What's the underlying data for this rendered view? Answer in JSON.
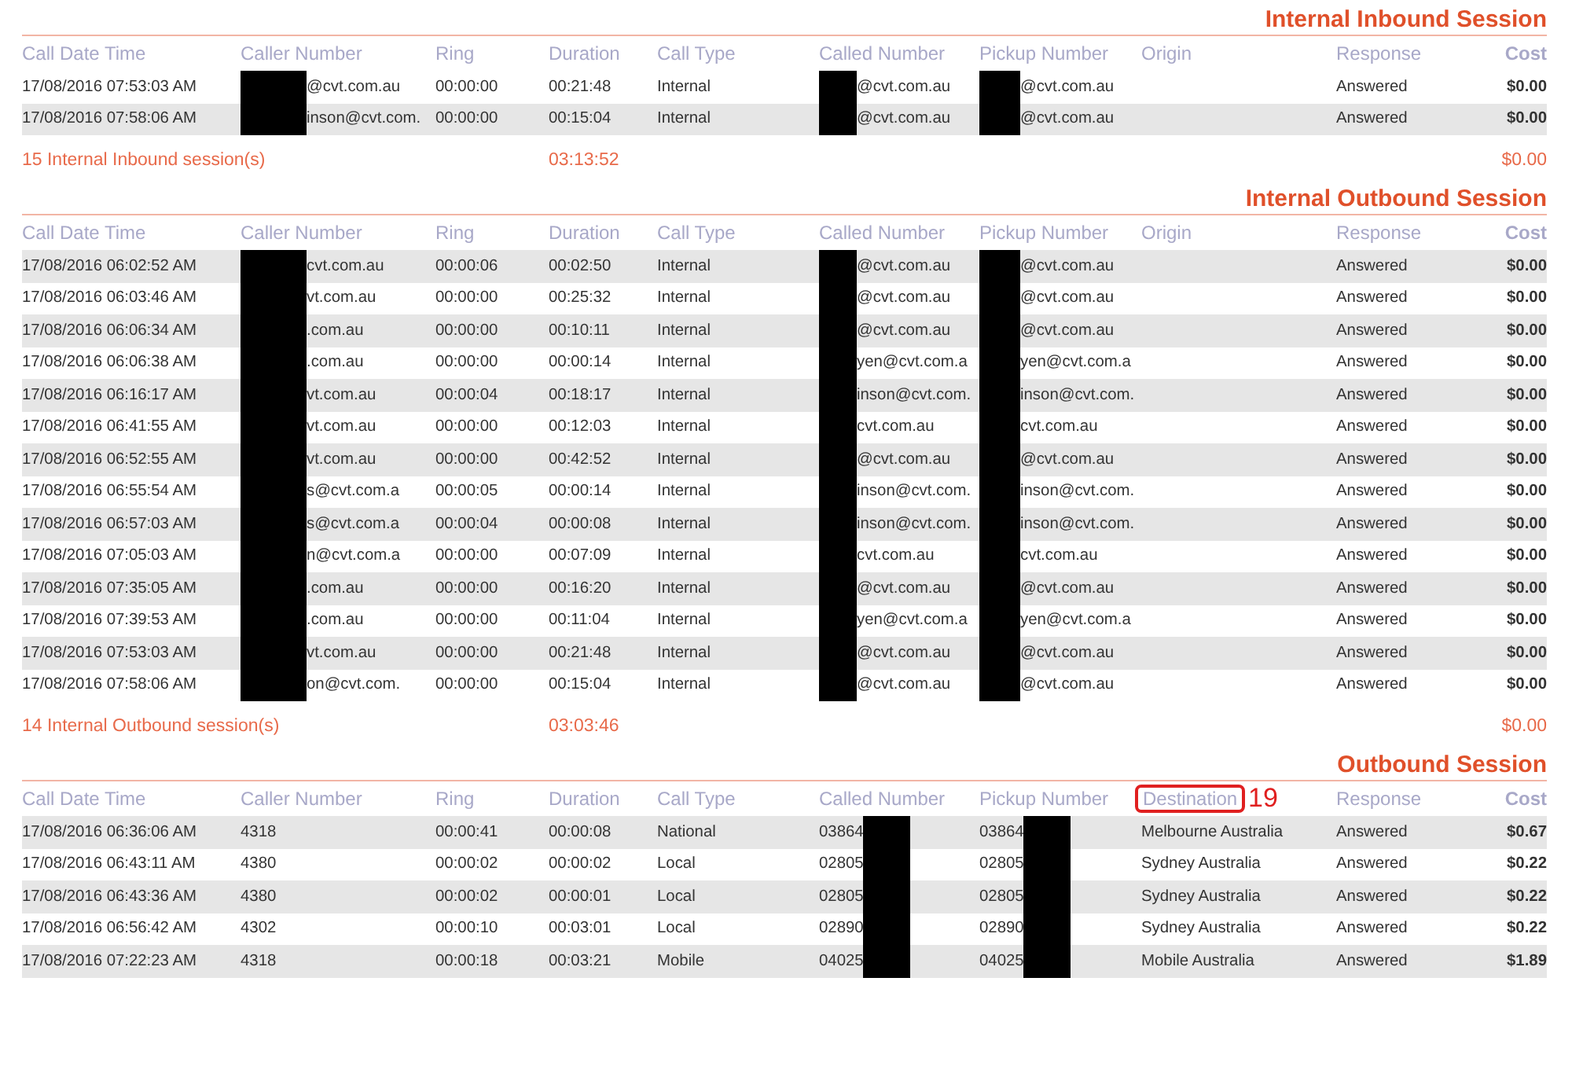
{
  "sections": [
    {
      "title": "Internal Inbound Session",
      "columns": [
        {
          "label": "Call Date Time"
        },
        {
          "label": "Caller Number"
        },
        {
          "label": "Ring"
        },
        {
          "label": "Duration"
        },
        {
          "label": "Call Type"
        },
        {
          "label": "Called Number"
        },
        {
          "label": "Pickup Number"
        },
        {
          "label": "Origin"
        },
        {
          "label": "Response"
        },
        {
          "label": "Cost"
        }
      ],
      "rows": [
        {
          "shaded": false,
          "date": "17/08/2016 07:53:03 AM",
          "caller": {
            "text": "@cvt.com.au",
            "redacted_before": true
          },
          "ring": "00:00:00",
          "duration": "00:21:48",
          "call_type": "Internal",
          "called": {
            "text": "@cvt.com.au",
            "redacted_before": true
          },
          "pickup": {
            "text": "@cvt.com.au",
            "redacted_before": true
          },
          "response": "Answered",
          "cost": "$0.00"
        },
        {
          "shaded": true,
          "date": "17/08/2016 07:58:06 AM",
          "caller": {
            "text": "inson@cvt.com.",
            "redacted_before": true
          },
          "ring": "00:00:00",
          "duration": "00:15:04",
          "call_type": "Internal",
          "called": {
            "text": "@cvt.com.au",
            "redacted_before": true
          },
          "pickup": {
            "text": "@cvt.com.au",
            "redacted_before": true
          },
          "response": "Answered",
          "cost": "$0.00"
        }
      ],
      "summary": {
        "count": "15 Internal Inbound session(s)",
        "total_duration": "03:13:52",
        "total_cost": "$0.00"
      }
    },
    {
      "title": "Internal Outbound Session",
      "columns": [
        {
          "label": "Call Date Time"
        },
        {
          "label": "Caller Number"
        },
        {
          "label": "Ring"
        },
        {
          "label": "Duration"
        },
        {
          "label": "Call Type"
        },
        {
          "label": "Called Number"
        },
        {
          "label": "Pickup Number"
        },
        {
          "label": "Origin"
        },
        {
          "label": "Response"
        },
        {
          "label": "Cost"
        }
      ],
      "rows": [
        {
          "shaded": true,
          "date": "17/08/2016 06:02:52 AM",
          "caller": {
            "text": "cvt.com.au",
            "redacted_before": true
          },
          "ring": "00:00:06",
          "duration": "00:02:50",
          "call_type": "Internal",
          "called": {
            "text": "@cvt.com.au",
            "redacted_before": true
          },
          "pickup": {
            "text": "@cvt.com.au",
            "redacted_before": true
          },
          "response": "Answered",
          "cost": "$0.00"
        },
        {
          "shaded": false,
          "date": "17/08/2016 06:03:46 AM",
          "caller": {
            "text": "vt.com.au",
            "redacted_before": true
          },
          "ring": "00:00:00",
          "duration": "00:25:32",
          "call_type": "Internal",
          "called": {
            "text": "@cvt.com.au",
            "redacted_before": true
          },
          "pickup": {
            "text": "@cvt.com.au",
            "redacted_before": true
          },
          "response": "Answered",
          "cost": "$0.00"
        },
        {
          "shaded": true,
          "date": "17/08/2016 06:06:34 AM",
          "caller": {
            "text": ".com.au",
            "redacted_before": true
          },
          "ring": "00:00:00",
          "duration": "00:10:11",
          "call_type": "Internal",
          "called": {
            "text": "@cvt.com.au",
            "redacted_before": true
          },
          "pickup": {
            "text": "@cvt.com.au",
            "redacted_before": true
          },
          "response": "Answered",
          "cost": "$0.00"
        },
        {
          "shaded": false,
          "date": "17/08/2016 06:06:38 AM",
          "caller": {
            "text": ".com.au",
            "redacted_before": true
          },
          "ring": "00:00:00",
          "duration": "00:00:14",
          "call_type": "Internal",
          "called": {
            "text": "yen@cvt.com.a",
            "redacted_before": true
          },
          "pickup": {
            "text": "yen@cvt.com.a",
            "redacted_before": true
          },
          "response": "Answered",
          "cost": "$0.00"
        },
        {
          "shaded": true,
          "date": "17/08/2016 06:16:17 AM",
          "caller": {
            "text": "vt.com.au",
            "redacted_before": true
          },
          "ring": "00:00:04",
          "duration": "00:18:17",
          "call_type": "Internal",
          "called": {
            "text": "inson@cvt.com.",
            "redacted_before": true
          },
          "pickup": {
            "text": "inson@cvt.com.",
            "redacted_before": true
          },
          "response": "Answered",
          "cost": "$0.00"
        },
        {
          "shaded": false,
          "date": "17/08/2016 06:41:55 AM",
          "caller": {
            "text": "vt.com.au",
            "redacted_before": true
          },
          "ring": "00:00:00",
          "duration": "00:12:03",
          "call_type": "Internal",
          "called": {
            "text": "cvt.com.au",
            "redacted_before": true
          },
          "pickup": {
            "text": "cvt.com.au",
            "redacted_before": true
          },
          "response": "Answered",
          "cost": "$0.00"
        },
        {
          "shaded": true,
          "date": "17/08/2016 06:52:55 AM",
          "caller": {
            "text": "vt.com.au",
            "redacted_before": true
          },
          "ring": "00:00:00",
          "duration": "00:42:52",
          "call_type": "Internal",
          "called": {
            "text": "@cvt.com.au",
            "redacted_before": true
          },
          "pickup": {
            "text": "@cvt.com.au",
            "redacted_before": true
          },
          "response": "Answered",
          "cost": "$0.00"
        },
        {
          "shaded": false,
          "date": "17/08/2016 06:55:54 AM",
          "caller": {
            "text": "s@cvt.com.a",
            "redacted_before": true
          },
          "ring": "00:00:05",
          "duration": "00:00:14",
          "call_type": "Internal",
          "called": {
            "text": "inson@cvt.com.",
            "redacted_before": true
          },
          "pickup": {
            "text": "inson@cvt.com.",
            "redacted_before": true
          },
          "response": "Answered",
          "cost": "$0.00"
        },
        {
          "shaded": true,
          "date": "17/08/2016 06:57:03 AM",
          "caller": {
            "text": "s@cvt.com.a",
            "redacted_before": true
          },
          "ring": "00:00:04",
          "duration": "00:00:08",
          "call_type": "Internal",
          "called": {
            "text": "inson@cvt.com.",
            "redacted_before": true
          },
          "pickup": {
            "text": "inson@cvt.com.",
            "redacted_before": true
          },
          "response": "Answered",
          "cost": "$0.00"
        },
        {
          "shaded": false,
          "date": "17/08/2016 07:05:03 AM",
          "caller": {
            "text": "n@cvt.com.a",
            "redacted_before": true
          },
          "ring": "00:00:00",
          "duration": "00:07:09",
          "call_type": "Internal",
          "called": {
            "text": "cvt.com.au",
            "redacted_before": true
          },
          "pickup": {
            "text": "cvt.com.au",
            "redacted_before": true
          },
          "response": "Answered",
          "cost": "$0.00"
        },
        {
          "shaded": true,
          "date": "17/08/2016 07:35:05 AM",
          "caller": {
            "text": ".com.au",
            "redacted_before": true
          },
          "ring": "00:00:00",
          "duration": "00:16:20",
          "call_type": "Internal",
          "called": {
            "text": "@cvt.com.au",
            "redacted_before": true
          },
          "pickup": {
            "text": "@cvt.com.au",
            "redacted_before": true
          },
          "response": "Answered",
          "cost": "$0.00"
        },
        {
          "shaded": false,
          "date": "17/08/2016 07:39:53 AM",
          "caller": {
            "text": ".com.au",
            "redacted_before": true
          },
          "ring": "00:00:00",
          "duration": "00:11:04",
          "call_type": "Internal",
          "called": {
            "text": "yen@cvt.com.a",
            "redacted_before": true
          },
          "pickup": {
            "text": "yen@cvt.com.a",
            "redacted_before": true
          },
          "response": "Answered",
          "cost": "$0.00"
        },
        {
          "shaded": true,
          "date": "17/08/2016 07:53:03 AM",
          "caller": {
            "text": "vt.com.au",
            "redacted_before": true
          },
          "ring": "00:00:00",
          "duration": "00:21:48",
          "call_type": "Internal",
          "called": {
            "text": "@cvt.com.au",
            "redacted_before": true
          },
          "pickup": {
            "text": "@cvt.com.au",
            "redacted_before": true
          },
          "response": "Answered",
          "cost": "$0.00"
        },
        {
          "shaded": false,
          "date": "17/08/2016 07:58:06 AM",
          "caller": {
            "text": "on@cvt.com.",
            "redacted_before": true
          },
          "ring": "00:00:00",
          "duration": "00:15:04",
          "call_type": "Internal",
          "called": {
            "text": "@cvt.com.au",
            "redacted_before": true
          },
          "pickup": {
            "text": "@cvt.com.au",
            "redacted_before": true
          },
          "response": "Answered",
          "cost": "$0.00"
        }
      ],
      "summary": {
        "count": "14 Internal Outbound session(s)",
        "total_duration": "03:03:46",
        "total_cost": "$0.00"
      }
    },
    {
      "title": "Outbound Session",
      "columns": [
        {
          "label": "Call Date Time"
        },
        {
          "label": "Caller Number"
        },
        {
          "label": "Ring"
        },
        {
          "label": "Duration"
        },
        {
          "label": "Call Type"
        },
        {
          "label": "Called Number"
        },
        {
          "label": "Pickup Number"
        },
        {
          "label": "Destination",
          "annotation": "19"
        },
        {
          "label": "Response"
        },
        {
          "label": "Cost"
        }
      ],
      "rows": [
        {
          "shaded": true,
          "date": "17/08/2016 06:36:06 AM",
          "caller": {
            "text": "4318"
          },
          "ring": "00:00:41",
          "duration": "00:00:08",
          "call_type": "National",
          "called": {
            "text": "03864",
            "redacted_after": true
          },
          "pickup": {
            "text": "03864",
            "redacted_after": true
          },
          "destination": "Melbourne Australia",
          "response": "Answered",
          "cost": "$0.67"
        },
        {
          "shaded": false,
          "date": "17/08/2016 06:43:11 AM",
          "caller": {
            "text": "4380"
          },
          "ring": "00:00:02",
          "duration": "00:00:02",
          "call_type": "Local",
          "called": {
            "text": "02805",
            "redacted_after": true
          },
          "pickup": {
            "text": "02805",
            "redacted_after": true
          },
          "destination": "Sydney Australia",
          "response": "Answered",
          "cost": "$0.22"
        },
        {
          "shaded": true,
          "date": "17/08/2016 06:43:36 AM",
          "caller": {
            "text": "4380"
          },
          "ring": "00:00:02",
          "duration": "00:00:01",
          "call_type": "Local",
          "called": {
            "text": "02805",
            "redacted_after": true
          },
          "pickup": {
            "text": "02805",
            "redacted_after": true
          },
          "destination": "Sydney Australia",
          "response": "Answered",
          "cost": "$0.22"
        },
        {
          "shaded": false,
          "date": "17/08/2016 06:56:42 AM",
          "caller": {
            "text": "4302"
          },
          "ring": "00:00:10",
          "duration": "00:03:01",
          "call_type": "Local",
          "called": {
            "text": "02890",
            "redacted_after": true
          },
          "pickup": {
            "text": "02890",
            "redacted_after": true
          },
          "destination": "Sydney Australia",
          "response": "Answered",
          "cost": "$0.22"
        },
        {
          "shaded": true,
          "date": "17/08/2016 07:22:23 AM",
          "caller": {
            "text": "4318"
          },
          "ring": "00:00:18",
          "duration": "00:03:21",
          "call_type": "Mobile",
          "called": {
            "text": "04025",
            "redacted_after": true
          },
          "pickup": {
            "text": "04025",
            "redacted_after": true
          },
          "destination": "Mobile Australia",
          "response": "Answered",
          "cost": "$1.89"
        }
      ]
    }
  ]
}
